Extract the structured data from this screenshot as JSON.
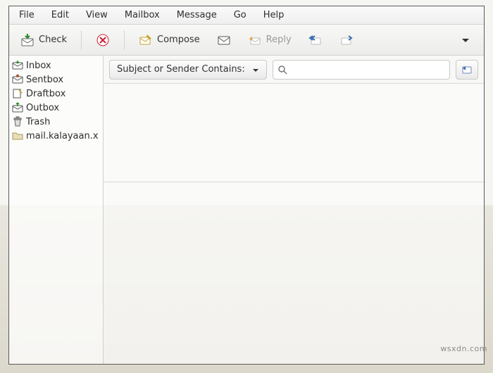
{
  "menu": {
    "file": "File",
    "edit": "Edit",
    "view": "View",
    "mailbox": "Mailbox",
    "message": "Message",
    "go": "Go",
    "help": "Help"
  },
  "toolbar": {
    "check": "Check",
    "compose": "Compose",
    "reply": "Reply"
  },
  "sidebar": {
    "items": [
      {
        "label": "Inbox"
      },
      {
        "label": "Sentbox"
      },
      {
        "label": "Draftbox"
      },
      {
        "label": "Outbox"
      },
      {
        "label": "Trash"
      },
      {
        "label": "mail.kalayaan.x"
      }
    ]
  },
  "filter": {
    "combo_label": "Subject or Sender Contains:",
    "search_placeholder": ""
  },
  "watermark": "wsxdn.com"
}
